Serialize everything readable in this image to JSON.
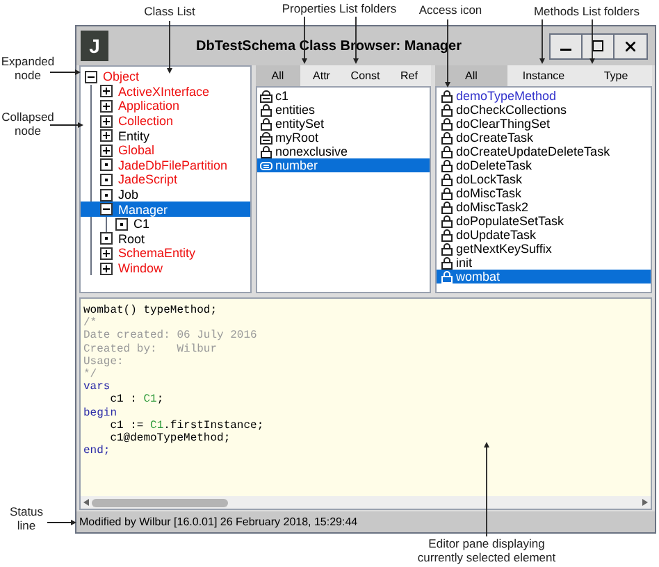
{
  "annotations": [
    {
      "text": "Class List"
    },
    {
      "text": "Properties List folders"
    },
    {
      "text": "Access icon"
    },
    {
      "text": "Methods List folders"
    },
    {
      "text": "Expanded node"
    },
    {
      "text": "Collapsed node"
    },
    {
      "text": "Status line"
    },
    {
      "text": "Editor pane displaying currently selected element"
    }
  ],
  "window": {
    "logo": "J",
    "title": "DbTestSchema Class Browser: Manager"
  },
  "class_list": [
    {
      "label": "Object",
      "kind": "expanded",
      "flagged": true,
      "selected": false,
      "children": [
        {
          "label": "ActiveXInterface",
          "kind": "collapsed",
          "flagged": true,
          "selected": false
        },
        {
          "label": "Application",
          "kind": "collapsed",
          "flagged": true,
          "selected": false
        },
        {
          "label": "Collection",
          "kind": "collapsed",
          "flagged": true,
          "selected": false
        },
        {
          "label": "Entity",
          "kind": "collapsed",
          "flagged": false,
          "selected": false
        },
        {
          "label": "Global",
          "kind": "collapsed",
          "flagged": true,
          "selected": false
        },
        {
          "label": "JadeDbFilePartition",
          "kind": "leaf",
          "flagged": true,
          "selected": false
        },
        {
          "label": "JadeScript",
          "kind": "leaf",
          "flagged": true,
          "selected": false
        },
        {
          "label": "Job",
          "kind": "leaf",
          "flagged": false,
          "selected": false
        },
        {
          "label": "Manager",
          "kind": "expanded",
          "selected": true,
          "children": [
            {
              "label": "C1",
              "kind": "leaf",
              "flagged": false,
              "selected": false
            }
          ]
        },
        {
          "label": "Root",
          "kind": "leaf",
          "flagged": false,
          "selected": false
        },
        {
          "label": "SchemaEntity",
          "kind": "collapsed",
          "flagged": true,
          "selected": false
        },
        {
          "label": "Window",
          "kind": "collapsed",
          "flagged": true,
          "selected": false
        }
      ]
    }
  ],
  "properties": {
    "tabs": [
      {
        "label": "All",
        "selected": true
      },
      {
        "label": "Attr",
        "selected": false
      },
      {
        "label": "Const",
        "selected": false
      },
      {
        "label": "Ref",
        "selected": false
      }
    ],
    "items": [
      {
        "label": "c1",
        "kind": "reference",
        "selected": false
      },
      {
        "label": "entities",
        "kind": "lock",
        "selected": false
      },
      {
        "label": "entitySet",
        "kind": "lock",
        "selected": false
      },
      {
        "label": "myRoot",
        "kind": "reference",
        "selected": false
      },
      {
        "label": "nonexclusive",
        "kind": "lock",
        "selected": false
      },
      {
        "label": "number",
        "kind": "attribute",
        "selected": true
      }
    ]
  },
  "methods": {
    "tabs": [
      {
        "label": "All",
        "selected": true
      },
      {
        "label": "Instance",
        "selected": false
      },
      {
        "label": "Type",
        "selected": false
      }
    ],
    "items": [
      {
        "label": "demoTypeMethod",
        "type_method": true,
        "selected": false
      },
      {
        "label": "doCheckCollections",
        "type_method": false,
        "selected": false
      },
      {
        "label": "doClearThingSet",
        "type_method": false,
        "selected": false
      },
      {
        "label": "doCreateTask",
        "type_method": false,
        "selected": false
      },
      {
        "label": "doCreateUpdateDeleteTask",
        "type_method": false,
        "selected": false
      },
      {
        "label": "doDeleteTask",
        "type_method": false,
        "selected": false
      },
      {
        "label": "doLockTask",
        "type_method": false,
        "selected": false
      },
      {
        "label": "doMiscTask",
        "type_method": false,
        "selected": false
      },
      {
        "label": "doMiscTask2",
        "type_method": false,
        "selected": false
      },
      {
        "label": "doPopulateSetTask",
        "type_method": false,
        "selected": false
      },
      {
        "label": "doUpdateTask",
        "type_method": false,
        "selected": false
      },
      {
        "label": "getNextKeySuffix",
        "type_method": false,
        "selected": false
      },
      {
        "label": "init",
        "type_method": false,
        "selected": false
      },
      {
        "label": "wombat",
        "selected": true
      }
    ]
  },
  "editor": {
    "lines": [
      [
        {
          "text": "wombat() typeMethod;",
          "kind": "plain"
        }
      ],
      [
        {
          "text": "/*",
          "kind": "comment"
        }
      ],
      [
        {
          "text": "Date created: 06 July 2016",
          "kind": "comment"
        }
      ],
      [
        {
          "text": "Created by:   Wilbur",
          "kind": "comment"
        }
      ],
      [
        {
          "text": "Usage:",
          "kind": "comment"
        }
      ],
      [
        {
          "text": "*/",
          "kind": "comment"
        }
      ],
      [
        {
          "text": "vars",
          "kind": "keyword"
        }
      ],
      [
        {
          "text": "    c1 : ",
          "kind": "plain"
        },
        {
          "text": "C1",
          "kind": "class"
        },
        {
          "text": ";",
          "kind": "plain"
        }
      ],
      [
        {
          "text": "begin",
          "kind": "keyword"
        }
      ],
      [
        {
          "text": "    c1 := ",
          "kind": "plain"
        },
        {
          "text": "C1",
          "kind": "class"
        },
        {
          "text": ".firstInstance;",
          "kind": "plain"
        }
      ],
      [
        {
          "text": "    c1@demoTypeMethod;",
          "kind": "plain"
        }
      ],
      [
        {
          "text": "end;",
          "kind": "keyword"
        }
      ]
    ]
  },
  "status_bar": {
    "text": "Modified by Wilbur [16.0.01] 26 February 2018, 15:29:44"
  }
}
